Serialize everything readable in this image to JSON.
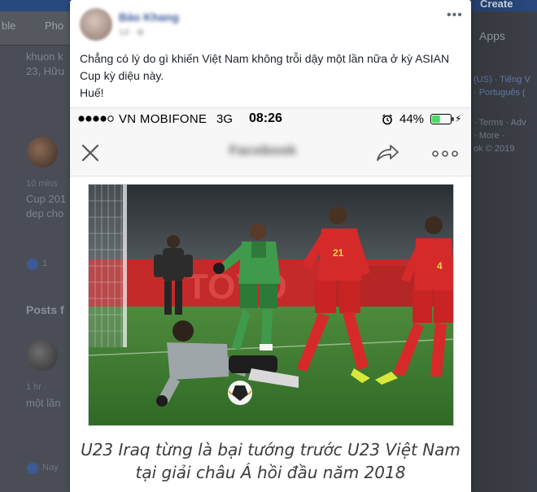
{
  "background": {
    "top_right_button": "Create",
    "nav_items": [
      "ble",
      "Pho"
    ],
    "apps_label": "Apps",
    "left_snippets": [
      "khuon k",
      "23, Hữu",
      "10 mins",
      "Cup 201",
      "dep cho",
      "1",
      "1 hr ·",
      "một lần",
      "Nay"
    ],
    "posts_heading": "Posts f",
    "right_footer": [
      "(US) · Tiếng V",
      "· Português (",
      "· Terms · Adv",
      "· More ·",
      "ok © 2019"
    ]
  },
  "post": {
    "author": "Bảo Khang",
    "meta": "1d · ⊕",
    "menu_icon": "more-horizontal-icon",
    "body": "Chẳng có lý do gì khiến Việt Nam không trỗi dậy một lần nữa ở kỳ ASIAN Cup kỳ diệu này.",
    "sign": "Huế!"
  },
  "phone": {
    "carrier": "VN MOBIFONE",
    "network": "3G",
    "time": "08:26",
    "battery_percent": "44%",
    "battery_level": 0.44,
    "nav_title": "Facebook",
    "caption_line1": "U23 Iraq từng là bại tướng trước U23 Việt Nam",
    "caption_line2": "tại giải châu Á hồi đầu năm 2018"
  },
  "colors": {
    "fb_blue": "#3b5998",
    "battery_green": "#4cd964",
    "iraq_green": "#3f9a4c",
    "vietnam_red": "#d62a2a"
  }
}
